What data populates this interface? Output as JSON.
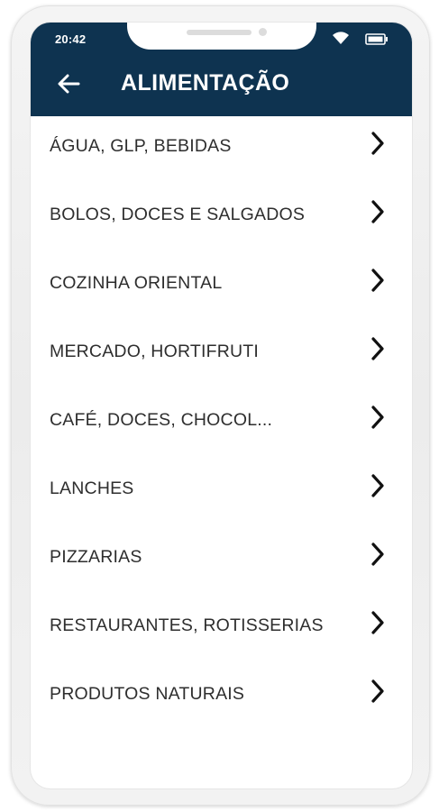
{
  "status_bar": {
    "time": "20:42",
    "wifi_icon": "wifi-icon",
    "battery_icon": "battery-icon"
  },
  "header": {
    "title": "ALIMENTAÇÃO",
    "back_icon": "arrow-left-icon",
    "background_color": "#0e3350"
  },
  "categories": [
    {
      "label": "ÁGUA, GLP, BEBIDAS",
      "icon": "chevron-right-icon"
    },
    {
      "label": "BOLOS, DOCES E SALGADOS",
      "icon": "chevron-right-icon"
    },
    {
      "label": "COZINHA ORIENTAL",
      "icon": "chevron-right-icon"
    },
    {
      "label": "MERCADO, HORTIFRUTI",
      "icon": "chevron-right-icon"
    },
    {
      "label": "CAFÉ, DOCES, CHOCOL...",
      "icon": "chevron-right-icon"
    },
    {
      "label": "LANCHES",
      "icon": "chevron-right-icon"
    },
    {
      "label": "PIZZARIAS",
      "icon": "chevron-right-icon"
    },
    {
      "label": "RESTAURANTES, ROTISSERIAS",
      "icon": "chevron-right-icon"
    },
    {
      "label": "PRODUTOS NATURAIS",
      "icon": "chevron-right-icon"
    }
  ]
}
